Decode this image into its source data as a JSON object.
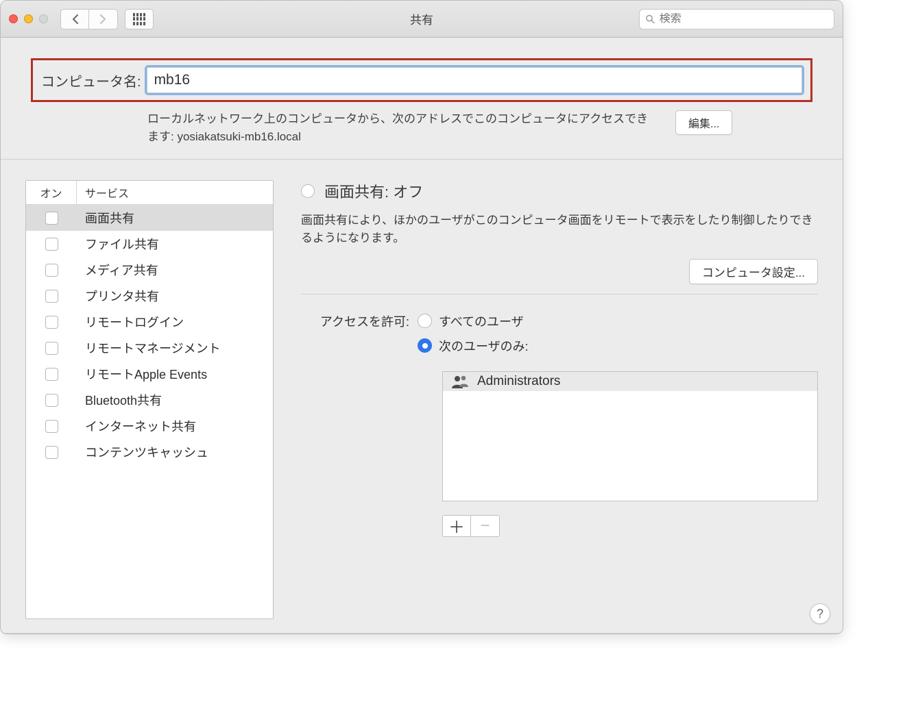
{
  "window": {
    "title": "共有"
  },
  "search": {
    "placeholder": "検索"
  },
  "computerName": {
    "label": "コンピュータ名:",
    "value": "mb16",
    "description": "ローカルネットワーク上のコンピュータから、次のアドレスでこのコンピュータにアクセスできます: yosiakatsuki-mb16.local",
    "editButton": "編集..."
  },
  "services": {
    "headerOn": "オン",
    "headerService": "サービス",
    "items": [
      {
        "label": "画面共有",
        "selected": true
      },
      {
        "label": "ファイル共有",
        "selected": false
      },
      {
        "label": "メディア共有",
        "selected": false
      },
      {
        "label": "プリンタ共有",
        "selected": false
      },
      {
        "label": "リモートログイン",
        "selected": false
      },
      {
        "label": "リモートマネージメント",
        "selected": false
      },
      {
        "label": "リモートApple Events",
        "selected": false
      },
      {
        "label": "Bluetooth共有",
        "selected": false
      },
      {
        "label": "インターネット共有",
        "selected": false
      },
      {
        "label": "コンテンツキャッシュ",
        "selected": false
      }
    ]
  },
  "detail": {
    "title": "画面共有: オフ",
    "description": "画面共有により、ほかのユーザがこのコンピュータ画面をリモートで表示をしたり制御したりできるようになります。",
    "settingsButton": "コンピュータ設定...",
    "accessLabel": "アクセスを許可:",
    "accessOptions": {
      "allUsers": "すべてのユーザ",
      "onlyUsers": "次のユーザのみ:"
    },
    "users": [
      {
        "name": "Administrators"
      }
    ]
  },
  "help": "?"
}
